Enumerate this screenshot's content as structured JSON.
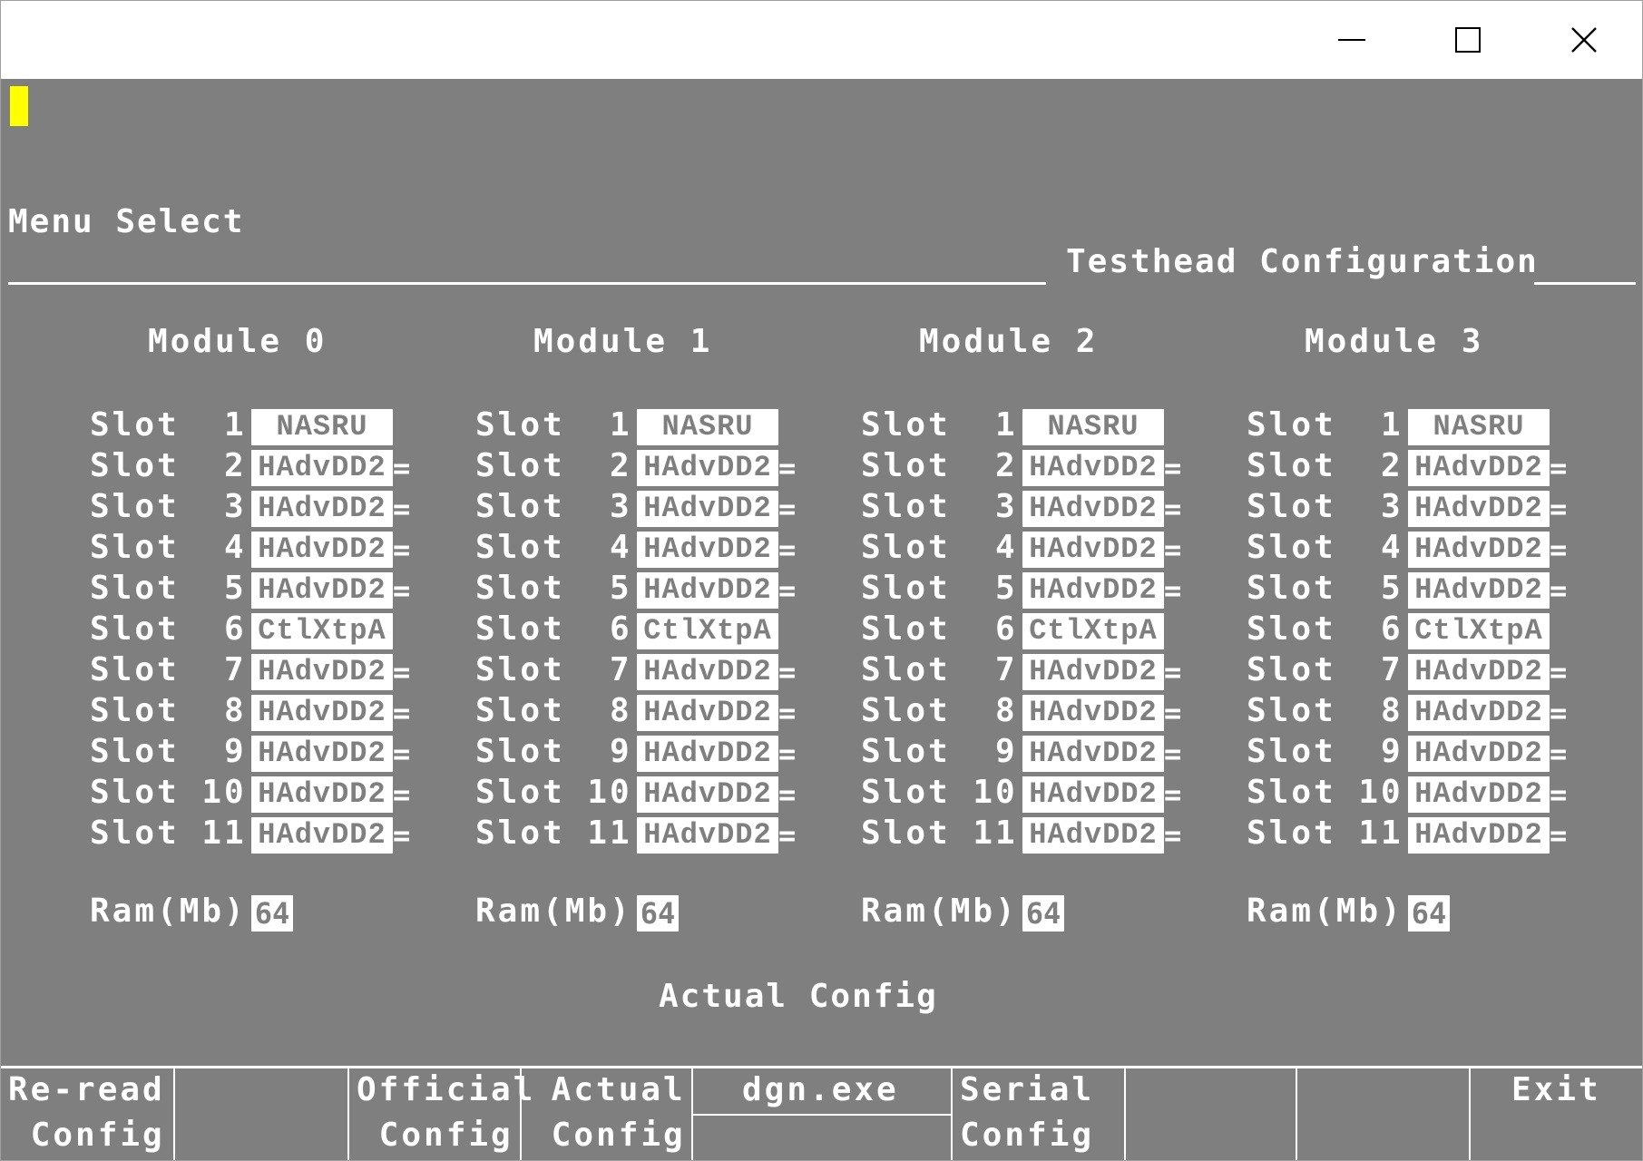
{
  "window": {
    "controls": {
      "minimize": "minimize-icon",
      "maximize": "maximize-icon",
      "close": "close-icon"
    }
  },
  "terminal": {
    "menu_title": "Menu Select",
    "section_title": "Testhead Configuration",
    "status": "Actual Config",
    "cursor_color": "#ffff00",
    "background_color": "#7f7f7f"
  },
  "modules": [
    {
      "title": "Module 0",
      "slots": [
        {
          "label": "Slot  1",
          "value": "NASRU",
          "tail": ""
        },
        {
          "label": "Slot  2",
          "value": "HAdvDD2",
          "tail": "="
        },
        {
          "label": "Slot  3",
          "value": "HAdvDD2",
          "tail": "="
        },
        {
          "label": "Slot  4",
          "value": "HAdvDD2",
          "tail": "="
        },
        {
          "label": "Slot  5",
          "value": "HAdvDD2",
          "tail": "="
        },
        {
          "label": "Slot  6",
          "value": "CtlXtpA",
          "tail": ""
        },
        {
          "label": "Slot  7",
          "value": "HAdvDD2",
          "tail": "="
        },
        {
          "label": "Slot  8",
          "value": "HAdvDD2",
          "tail": "="
        },
        {
          "label": "Slot  9",
          "value": "HAdvDD2",
          "tail": "="
        },
        {
          "label": "Slot 10",
          "value": "HAdvDD2",
          "tail": "="
        },
        {
          "label": "Slot 11",
          "value": "HAdvDD2",
          "tail": "="
        }
      ],
      "ram_label": "Ram(Mb)",
      "ram_value": "64"
    },
    {
      "title": "Module 1",
      "slots": [
        {
          "label": "Slot  1",
          "value": "NASRU",
          "tail": ""
        },
        {
          "label": "Slot  2",
          "value": "HAdvDD2",
          "tail": "="
        },
        {
          "label": "Slot  3",
          "value": "HAdvDD2",
          "tail": "="
        },
        {
          "label": "Slot  4",
          "value": "HAdvDD2",
          "tail": "="
        },
        {
          "label": "Slot  5",
          "value": "HAdvDD2",
          "tail": "="
        },
        {
          "label": "Slot  6",
          "value": "CtlXtpA",
          "tail": ""
        },
        {
          "label": "Slot  7",
          "value": "HAdvDD2",
          "tail": "="
        },
        {
          "label": "Slot  8",
          "value": "HAdvDD2",
          "tail": "="
        },
        {
          "label": "Slot  9",
          "value": "HAdvDD2",
          "tail": "="
        },
        {
          "label": "Slot 10",
          "value": "HAdvDD2",
          "tail": "="
        },
        {
          "label": "Slot 11",
          "value": "HAdvDD2",
          "tail": "="
        }
      ],
      "ram_label": "Ram(Mb)",
      "ram_value": "64"
    },
    {
      "title": "Module 2",
      "slots": [
        {
          "label": "Slot  1",
          "value": "NASRU",
          "tail": ""
        },
        {
          "label": "Slot  2",
          "value": "HAdvDD2",
          "tail": "="
        },
        {
          "label": "Slot  3",
          "value": "HAdvDD2",
          "tail": "="
        },
        {
          "label": "Slot  4",
          "value": "HAdvDD2",
          "tail": "="
        },
        {
          "label": "Slot  5",
          "value": "HAdvDD2",
          "tail": "="
        },
        {
          "label": "Slot  6",
          "value": "CtlXtpA",
          "tail": ""
        },
        {
          "label": "Slot  7",
          "value": "HAdvDD2",
          "tail": "="
        },
        {
          "label": "Slot  8",
          "value": "HAdvDD2",
          "tail": "="
        },
        {
          "label": "Slot  9",
          "value": "HAdvDD2",
          "tail": "="
        },
        {
          "label": "Slot 10",
          "value": "HAdvDD2",
          "tail": "="
        },
        {
          "label": "Slot 11",
          "value": "HAdvDD2",
          "tail": "="
        }
      ],
      "ram_label": "Ram(Mb)",
      "ram_value": "64"
    },
    {
      "title": "Module 3",
      "slots": [
        {
          "label": "Slot  1",
          "value": "NASRU",
          "tail": ""
        },
        {
          "label": "Slot  2",
          "value": "HAdvDD2",
          "tail": "="
        },
        {
          "label": "Slot  3",
          "value": "HAdvDD2",
          "tail": "="
        },
        {
          "label": "Slot  4",
          "value": "HAdvDD2",
          "tail": "="
        },
        {
          "label": "Slot  5",
          "value": "HAdvDD2",
          "tail": "="
        },
        {
          "label": "Slot  6",
          "value": "CtlXtpA",
          "tail": ""
        },
        {
          "label": "Slot  7",
          "value": "HAdvDD2",
          "tail": "="
        },
        {
          "label": "Slot  8",
          "value": "HAdvDD2",
          "tail": "="
        },
        {
          "label": "Slot  9",
          "value": "HAdvDD2",
          "tail": "="
        },
        {
          "label": "Slot 10",
          "value": "HAdvDD2",
          "tail": "="
        },
        {
          "label": "Slot 11",
          "value": "HAdvDD2",
          "tail": "="
        }
      ],
      "ram_label": "Ram(Mb)",
      "ram_value": "64"
    }
  ],
  "function_keys": [
    {
      "line1": "Re-read",
      "line2": " Config"
    },
    {
      "line1": "",
      "line2": ""
    },
    {
      "line1": "Official",
      "line2": " Config"
    },
    {
      "line1": " Actual",
      "line2": " Config"
    },
    {
      "line1": "dgn.exe",
      "line2": ""
    },
    {
      "line1": "Serial",
      "line2": "Config"
    },
    {
      "line1": "",
      "line2": ""
    },
    {
      "line1": "",
      "line2": ""
    },
    {
      "line1": "Exit",
      "line2": ""
    }
  ]
}
